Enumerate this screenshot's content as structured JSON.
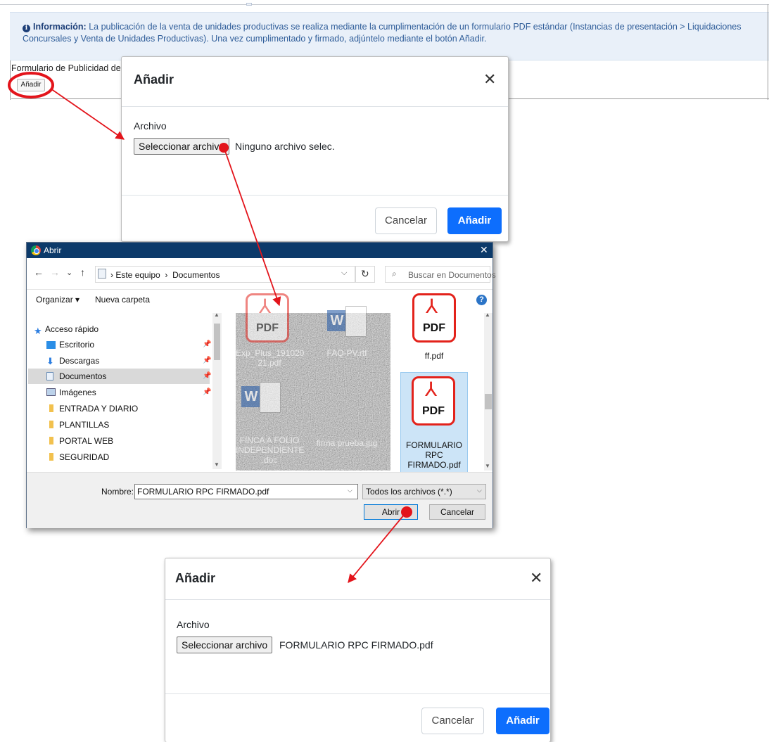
{
  "background_page": {
    "info_label": "Información:",
    "info_text": "La publicación de la venta de unidades productivas se realiza mediante la cumplimentación de un formulario PDF estándar (Instancias de presentación > Liquidaciones Concursales y Venta de Unidades Productivas). Una vez cumplimentado y firmado, adjúntelo mediante el botón Añadir.",
    "form_label": "Formulario de Publicidad de",
    "add_button": "Añadir"
  },
  "modal_before": {
    "title": "Añadir",
    "close_icon": "close-icon",
    "field_label": "Archivo",
    "file_button": "Seleccionar archivo",
    "file_status": "Ninguno archivo selec.",
    "cancel_button": "Cancelar",
    "submit_button": "Añadir"
  },
  "open_dialog": {
    "title": "Abrir",
    "close_glyph": "✕",
    "nav": {
      "back": "←",
      "forward": "→",
      "recent": "⌄",
      "up": "↑"
    },
    "breadcrumb": [
      "Este equipo",
      "Documentos"
    ],
    "search_placeholder": "Buscar en Documentos",
    "toolbar": {
      "organize": "Organizar ▾",
      "new_folder": "Nueva carpeta"
    },
    "sidebar": [
      {
        "label": "Acceso rápido",
        "icon": "star-icon",
        "pinned": false,
        "selected": false
      },
      {
        "label": "Escritorio",
        "icon": "desktop-icon",
        "pinned": true,
        "selected": false
      },
      {
        "label": "Descargas",
        "icon": "download-icon",
        "pinned": true,
        "selected": false
      },
      {
        "label": "Documentos",
        "icon": "documents-icon",
        "pinned": true,
        "selected": true
      },
      {
        "label": "Imágenes",
        "icon": "images-icon",
        "pinned": true,
        "selected": false
      },
      {
        "label": "ENTRADA Y DIARIO",
        "icon": "folder-icon",
        "pinned": false,
        "selected": false
      },
      {
        "label": "PLANTILLAS",
        "icon": "folder-icon",
        "pinned": false,
        "selected": false
      },
      {
        "label": "PORTAL WEB",
        "icon": "folder-icon",
        "pinned": false,
        "selected": false
      },
      {
        "label": "SEGURIDAD",
        "icon": "folder-icon",
        "pinned": false,
        "selected": false
      }
    ],
    "files": [
      {
        "name": "Exp_Plus_19102021.pdf",
        "type": "pdf",
        "obscured": true
      },
      {
        "name": "FAQ-PV.rtf",
        "type": "word",
        "obscured": true
      },
      {
        "name": "ff.pdf",
        "type": "pdf",
        "obscured": false
      },
      {
        "name": "FINCA A FOLIO INDEPENDIENTE.doc",
        "type": "word",
        "obscured": true
      },
      {
        "name": "firma prueba.jpg",
        "type": "image",
        "obscured": true
      },
      {
        "name": "FORMULARIO RPC FIRMADO.pdf",
        "type": "pdf",
        "obscured": false,
        "selected": true
      }
    ],
    "file_labels": {
      "exp": "Exp_Plus_191020 21.pdf",
      "faq": "FAQ-PV.rtf",
      "ff": "ff.pdf",
      "finca": "FINCA A FOLIO INDEPENDIENTE .doc",
      "firma": "firma prueba.jpg",
      "form_l1": "FORMULARIO",
      "form_l2": "RPC",
      "form_l3": "FIRMADO.pdf"
    },
    "pdf_icon_label": "PDF",
    "name_label": "Nombre:",
    "name_value": "FORMULARIO RPC FIRMADO.pdf",
    "filter_value": "Todos los archivos (*.*)",
    "open_button": "Abrir",
    "cancel_button": "Cancelar"
  },
  "modal_after": {
    "title": "Añadir",
    "close_icon": "close-icon",
    "field_label": "Archivo",
    "file_button": "Seleccionar archivo",
    "file_status": "FORMULARIO RPC FIRMADO.pdf",
    "cancel_button": "Cancelar",
    "submit_button": "Añadir"
  },
  "colors": {
    "primary": "#0d6efd",
    "annotation_red": "#e3141b",
    "info_bg": "#e9f0f9",
    "dialog_titlebar": "#0c3a6a",
    "pdf_red": "#e3221b",
    "selected_file_bg": "#cce4f7"
  }
}
